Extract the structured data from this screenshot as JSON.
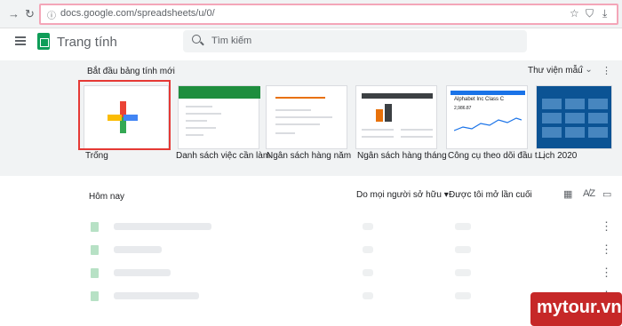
{
  "browser": {
    "url": "docs.google.com/spreadsheets/u/0/",
    "back_glyph": "→",
    "reload_glyph": "↻",
    "info_glyph": "ⓘ",
    "star_glyph": "☆"
  },
  "header": {
    "app_title": "Trang tính",
    "search_placeholder": "Tìm kiếm"
  },
  "templates": {
    "section_title": "Bắt đầu bảng tính mới",
    "gallery_label": "Thư viện mẫu",
    "gallery_glyph": "⌃⌄",
    "more_glyph": "⋮",
    "items": [
      {
        "label": "Trống"
      },
      {
        "label": "Danh sách việc cần làm"
      },
      {
        "label": "Ngân sách hàng năm"
      },
      {
        "label": "Ngân sách hàng tháng"
      },
      {
        "label": "Công cụ theo dõi đầu t..."
      },
      {
        "label": "Lịch 2020"
      }
    ],
    "stock_title": "Alphabet Inc Class C",
    "stock_value": "2,986.87"
  },
  "recent": {
    "section_title": "Hôm nay",
    "owner_filter": "Do mọi người sở hữu",
    "owner_caret": "▾",
    "sort_label": "Được tôi mở lần cuối",
    "grid_icon": "▦",
    "sort_az": "A̸Z",
    "folder_icon": "▭",
    "kebab": "⋮",
    "rows": [
      {
        "id": 1
      },
      {
        "id": 2
      },
      {
        "id": 3
      },
      {
        "id": 4
      }
    ]
  },
  "watermark": "mytour.vn"
}
